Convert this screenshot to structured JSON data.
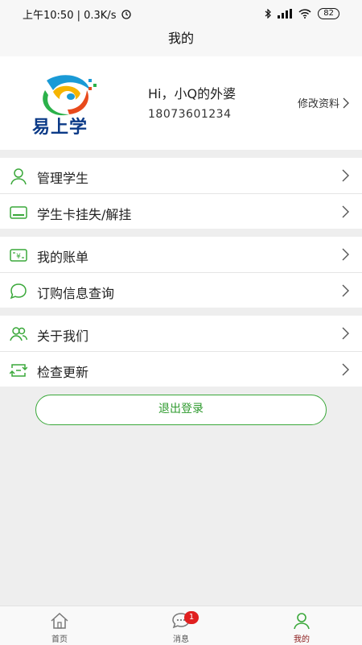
{
  "status_bar": {
    "time": "上午10:50 | 0.3K/s",
    "battery": "82"
  },
  "page_title": "我的",
  "profile": {
    "logo_text": "易上学",
    "greeting": "Hi，小Q的外婆",
    "phone": "18073601234",
    "edit_label": "修改资料"
  },
  "menu_groups": [
    {
      "items": [
        {
          "label": "管理学生",
          "icon": "person-icon"
        },
        {
          "label": "学生卡挂失/解挂",
          "icon": "card-icon"
        }
      ]
    },
    {
      "items": [
        {
          "label": "我的账单",
          "icon": "bill-icon"
        },
        {
          "label": "订购信息查询",
          "icon": "chat-bubble-icon"
        }
      ]
    },
    {
      "items": [
        {
          "label": "关于我们",
          "icon": "group-icon"
        },
        {
          "label": "检查更新",
          "icon": "refresh-icon"
        }
      ]
    }
  ],
  "logout_label": "退出登录",
  "tabs": [
    {
      "label": "首页",
      "icon": "home-icon"
    },
    {
      "label": "消息",
      "icon": "message-icon",
      "badge": "1"
    },
    {
      "label": "我的",
      "icon": "profile-icon",
      "active": true
    }
  ],
  "colors": {
    "accent": "#3aa83a",
    "active_tab": "#8a1a1a",
    "badge": "#e02020",
    "logo_blue": "#0b3a87"
  }
}
